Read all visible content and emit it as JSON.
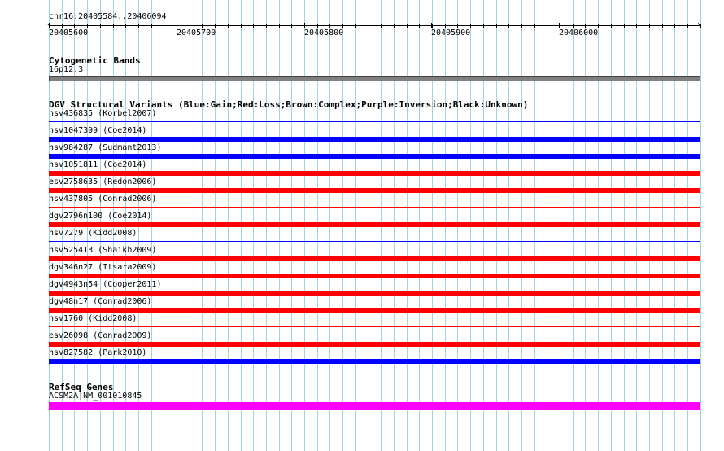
{
  "ruler": {
    "range_label": "chr16:20405584..20406094",
    "ticks": [
      "20405600",
      "20405700",
      "20405800",
      "20405900",
      "20406000"
    ]
  },
  "cytogenetic_bands": {
    "title": "Cytogenetic Bands",
    "band_label": "16p12.3",
    "band_color": "#808080"
  },
  "dgv": {
    "title": "DGV Structural Variants (Blue:Gain;Red:Loss;Brown:Complex;Purple:Inversion;Black:Unknown)",
    "colors": {
      "gain": "#0000FF",
      "loss": "#FF0000"
    },
    "variants": [
      {
        "label": "nsv436835 (Korbel2007)",
        "type": "gain",
        "style": "thin"
      },
      {
        "label": "nsv1047399 (Coe2014)",
        "type": "gain",
        "style": "thick"
      },
      {
        "label": "nsv984287 (Sudmant2013)",
        "type": "gain",
        "style": "thick"
      },
      {
        "label": "nsv1051811 (Coe2014)",
        "type": "loss",
        "style": "thick"
      },
      {
        "label": "esv2758635 (Redon2006)",
        "type": "loss",
        "style": "thick"
      },
      {
        "label": "nsv437805 (Conrad2006)",
        "type": "loss",
        "style": "thin"
      },
      {
        "label": "dgv2796n100 (Coe2014)",
        "type": "loss",
        "style": "thick"
      },
      {
        "label": "nsv7279 (Kidd2008)",
        "type": "gain",
        "style": "thin"
      },
      {
        "label": "nsv525413 (Shaikh2009)",
        "type": "loss",
        "style": "thick"
      },
      {
        "label": "dgv346n27 (Itsara2009)",
        "type": "loss",
        "style": "thick"
      },
      {
        "label": "dgv4943n54 (Cooper2011)",
        "type": "loss",
        "style": "thick"
      },
      {
        "label": "dgv48n17 (Conrad2006)",
        "type": "loss",
        "style": "thick"
      },
      {
        "label": "nsv1760 (Kidd2008)",
        "type": "loss",
        "style": "thin"
      },
      {
        "label": "esv26098 (Conrad2009)",
        "type": "loss",
        "style": "thick"
      },
      {
        "label": "nsv827582 (Park2010)",
        "type": "gain",
        "style": "thick"
      }
    ]
  },
  "refseq": {
    "title": "RefSeq Genes",
    "gene_label": "ACSM2A|NM_001010845",
    "gene_color": "#FF00FF"
  },
  "grid_color": "#9fd3e6"
}
